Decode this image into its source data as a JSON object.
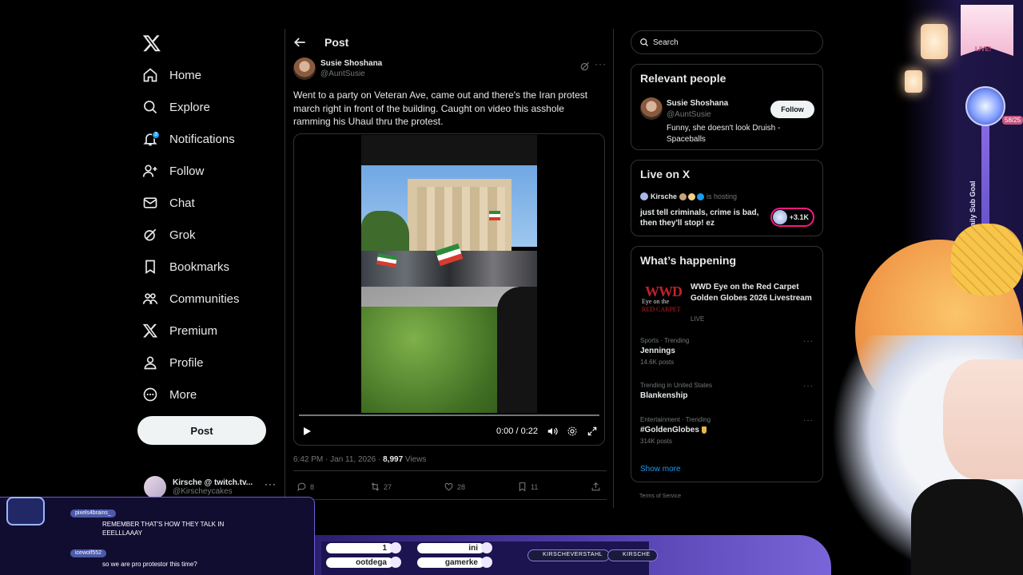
{
  "nav": {
    "items": [
      {
        "label": "Home",
        "icon": "home-icon"
      },
      {
        "label": "Explore",
        "icon": "search-icon"
      },
      {
        "label": "Notifications",
        "icon": "bell-icon",
        "badge": "3"
      },
      {
        "label": "Follow",
        "icon": "person-plus-icon"
      },
      {
        "label": "Chat",
        "icon": "mail-icon"
      },
      {
        "label": "Grok",
        "icon": "grok-icon"
      },
      {
        "label": "Bookmarks",
        "icon": "bookmark-icon"
      },
      {
        "label": "Communities",
        "icon": "communities-icon"
      },
      {
        "label": "Premium",
        "icon": "x-logo-icon"
      },
      {
        "label": "Profile",
        "icon": "person-icon"
      },
      {
        "label": "More",
        "icon": "more-circle-icon"
      }
    ],
    "post_button": "Post",
    "account": {
      "name": "Kirsche @ twitch.tv...",
      "handle": "@Kirscheycakes"
    }
  },
  "main": {
    "title": "Post",
    "tweet": {
      "author_name": "Susie Shoshana",
      "author_handle": "@AuntSusie",
      "text": "Went to a party on Veteran Ave, came out and there's the Iran protest march right in front of the building. Caught on video this asshole ramming his Uhaul thru the protest.",
      "video_time": "0:00 / 0:22",
      "video_progress": 0,
      "timestamp": "6:42 PM · Jan 11, 2026 · ",
      "views": "8,997",
      "views_label": " Views",
      "replies": "8",
      "reposts": "27",
      "likes": "28",
      "bookmarks": "11"
    }
  },
  "right": {
    "search_placeholder": "Search",
    "relevant": {
      "title": "Relevant people",
      "name": "Susie Shoshana",
      "handle": "@AuntSusie",
      "bio": "Funny, she doesn't look Druish - Spaceballs",
      "follow": "Follow"
    },
    "live": {
      "title": "Live on X",
      "host": "Kirsche",
      "hosting": "is hosting",
      "text": "just tell criminals, crime is bad, then they'll stop! ez",
      "count": "+3.1K"
    },
    "happening": {
      "title": "What’s happening",
      "event_title": "WWD Eye on the Red Carpet Golden Globes 2026 Livestream",
      "event_status": "LIVE",
      "thumb_logo": "WWD",
      "thumb_line1": "Eye on the",
      "thumb_line2": "RED CARPET",
      "trends": [
        {
          "context": "Sports · Trending",
          "title": "Jennings",
          "posts": "14.6K posts"
        },
        {
          "context": "Trending in United States",
          "title": "Blankenship",
          "posts": ""
        },
        {
          "context": "Entertainment · Trending",
          "title": "#GoldenGlobes",
          "posts": "314K posts"
        }
      ],
      "show_more": "Show more"
    },
    "terms": "Terms of Service"
  },
  "overlay": {
    "banner": "LIVE!",
    "goal_label": "Daily Sub Goal",
    "goal_count": "58/25",
    "slots": [
      "1",
      "ini",
      "ootdega",
      "gamerke"
    ],
    "socials": [
      "KIRSCHEVERSTAHL",
      "KIRSCHE"
    ],
    "chat": [
      {
        "user": "pixels4brains_",
        "text": "REMEMBER THAT'S HOW THEY TALK IN EEELLLAAAY"
      },
      {
        "user": "icewolf552",
        "text": "so we are pro protestor this time?"
      }
    ]
  },
  "colors": {
    "accent": "#1d9bf0",
    "background": "#000000",
    "border": "#2f3336",
    "muted": "#71767b",
    "live_pink": "#f91880"
  }
}
